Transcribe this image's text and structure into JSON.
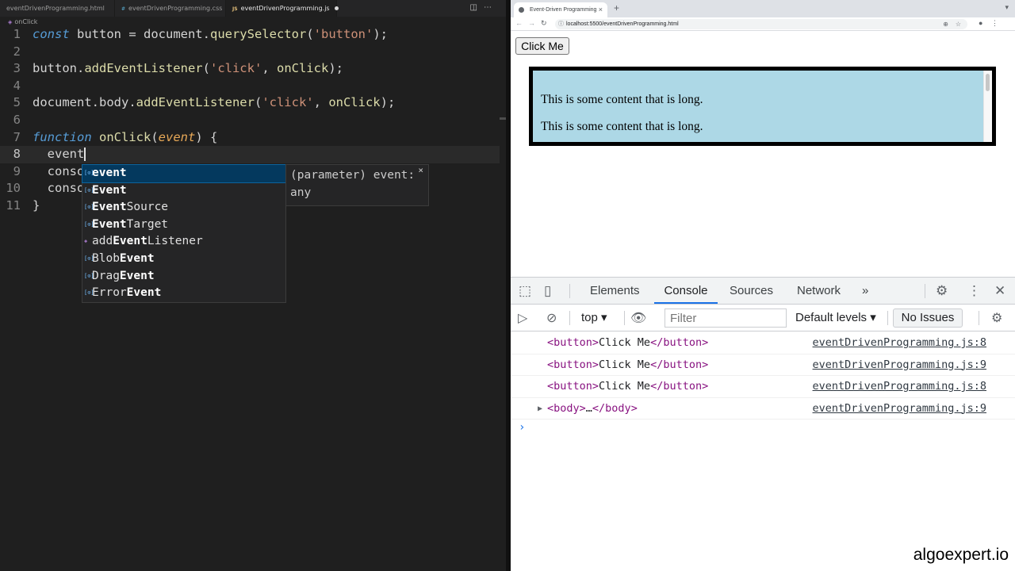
{
  "editor": {
    "tabs": [
      {
        "label": "eventDrivenProgramming.html",
        "icon": "html-file-icon",
        "active": false
      },
      {
        "label": "eventDrivenProgramming.css",
        "icon": "css-file-icon",
        "icon_glyph": "#",
        "active": false
      },
      {
        "label": "eventDrivenProgramming.js",
        "icon": "js-file-icon",
        "icon_glyph": "JS",
        "active": true,
        "unsaved": true
      }
    ],
    "breadcrumb": "onClick",
    "line_numbers": [
      "1",
      "2",
      "3",
      "4",
      "5",
      "6",
      "7",
      "8",
      "9",
      "10",
      "11"
    ],
    "code": {
      "l1": {
        "kw": "const",
        "a": " button = document.",
        "fn": "querySelector",
        "b": "(",
        "str": "'button'",
        "c": ");"
      },
      "l3": {
        "a": "button.",
        "fn": "addEventListener",
        "b": "(",
        "str": "'click'",
        "c": ", ",
        "fn2": "onClick",
        "d": ");"
      },
      "l5": {
        "a": "document.body.",
        "fn": "addEventListener",
        "b": "(",
        "str": "'click'",
        "c": ", ",
        "fn2": "onClick",
        "d": ");"
      },
      "l7": {
        "kw": "function",
        "a": " ",
        "fn": "onClick",
        "b": "(",
        "prm": "event",
        "c": ") {"
      },
      "l8": "  event",
      "l9": "  conso",
      "l10": "  conso",
      "l11": "}"
    },
    "suggestions": [
      {
        "pre": "",
        "hl": "event",
        "post": "",
        "selected": true
      },
      {
        "pre": "",
        "hl": "Event",
        "post": ""
      },
      {
        "pre": "",
        "hl": "Event",
        "post": "Source"
      },
      {
        "pre": "",
        "hl": "Event",
        "post": "Target"
      },
      {
        "pre": "add",
        "hl": "Event",
        "post": "Listener"
      },
      {
        "pre": "Blob",
        "hl": "Event",
        "post": ""
      },
      {
        "pre": "Drag",
        "hl": "Event",
        "post": ""
      },
      {
        "pre": "Error",
        "hl": "Event",
        "post": ""
      }
    ],
    "details": {
      "line1": "(parameter) event:",
      "line2": "any",
      "close": "×"
    }
  },
  "browser": {
    "tab_title": "Event-Driven Programming",
    "tab_close": "×",
    "new_tab": "+",
    "url": "localhost:5500/eventDrivenProgramming.html",
    "page": {
      "button_label": "Click Me",
      "paragraphs": [
        "This is some content that is long.",
        "This is some content that is long."
      ]
    },
    "devtools": {
      "tabs": [
        "Elements",
        "Console",
        "Sources",
        "Network"
      ],
      "active_tab": "Console",
      "more": "»",
      "context": "top",
      "filter_placeholder": "Filter",
      "levels": "Default levels",
      "issues": "No Issues",
      "logs": [
        {
          "open": "<button>",
          "text": "Click Me",
          "close": "</button>",
          "source": "eventDrivenProgramming.js:8"
        },
        {
          "open": "<button>",
          "text": "Click Me",
          "close": "</button>",
          "source": "eventDrivenProgramming.js:9"
        },
        {
          "open": "<button>",
          "text": "Click Me",
          "close": "</button>",
          "source": "eventDrivenProgramming.js:8"
        },
        {
          "open": "<body>",
          "text": "…",
          "close": "</body>",
          "source": "eventDrivenProgramming.js:9",
          "expandable": true
        }
      ],
      "prompt": "›"
    }
  },
  "watermark": "algoexpert.io",
  "colors": {
    "keyword": "#569cd6",
    "function": "#dcdcaa",
    "string": "#ce9178",
    "parameter": "#e7a857",
    "active_tab": "#1a73e8",
    "content_box": "#add8e6"
  }
}
